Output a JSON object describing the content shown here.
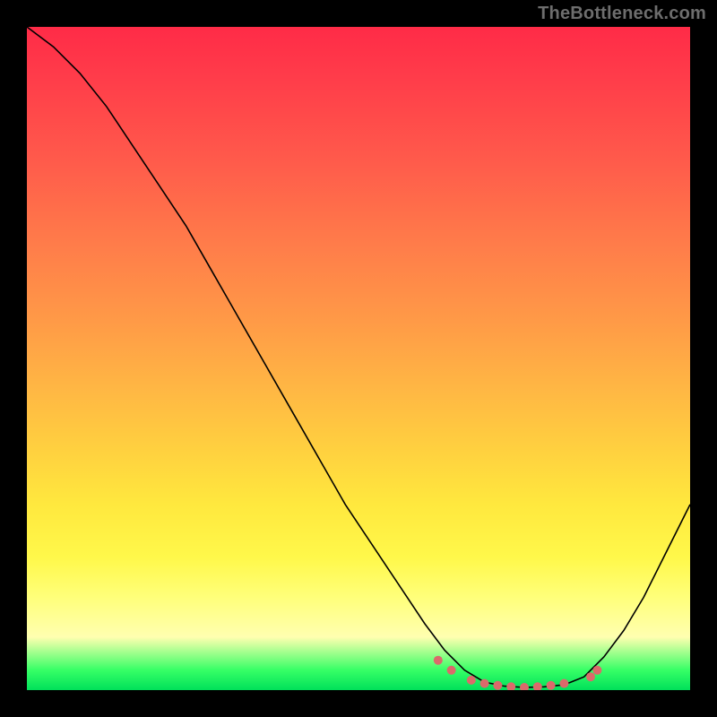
{
  "watermark": "TheBottleneck.com",
  "gradient_colors": {
    "top": "#ff2b47",
    "mid1": "#ff7a4a",
    "mid2": "#ffd13f",
    "pale": "#ffffb0",
    "bottom": "#00e05a"
  },
  "chart_data": {
    "type": "line",
    "title": "",
    "xlabel": "",
    "ylabel": "",
    "xlim": [
      0,
      100
    ],
    "ylim": [
      0,
      100
    ],
    "series": [
      {
        "name": "bottleneck-curve",
        "x": [
          0,
          4,
          8,
          12,
          16,
          20,
          24,
          28,
          32,
          36,
          40,
          44,
          48,
          52,
          56,
          60,
          63,
          66,
          69,
          72,
          75,
          78,
          81,
          84,
          87,
          90,
          93,
          96,
          100
        ],
        "y": [
          100,
          97,
          93,
          88,
          82,
          76,
          70,
          63,
          56,
          49,
          42,
          35,
          28,
          22,
          16,
          10,
          6,
          3,
          1.2,
          0.6,
          0.4,
          0.5,
          0.8,
          2.0,
          5.0,
          9.0,
          14,
          20,
          28
        ]
      }
    ],
    "markers": {
      "name": "optimal-range-markers",
      "color": "#db6a6b",
      "points": [
        {
          "x": 62,
          "y": 4.5
        },
        {
          "x": 64,
          "y": 3.0
        },
        {
          "x": 67,
          "y": 1.5
        },
        {
          "x": 69,
          "y": 1.0
        },
        {
          "x": 71,
          "y": 0.7
        },
        {
          "x": 73,
          "y": 0.5
        },
        {
          "x": 75,
          "y": 0.4
        },
        {
          "x": 77,
          "y": 0.5
        },
        {
          "x": 79,
          "y": 0.7
        },
        {
          "x": 81,
          "y": 1.0
        },
        {
          "x": 85,
          "y": 2.0
        },
        {
          "x": 86,
          "y": 3.0
        }
      ]
    }
  }
}
